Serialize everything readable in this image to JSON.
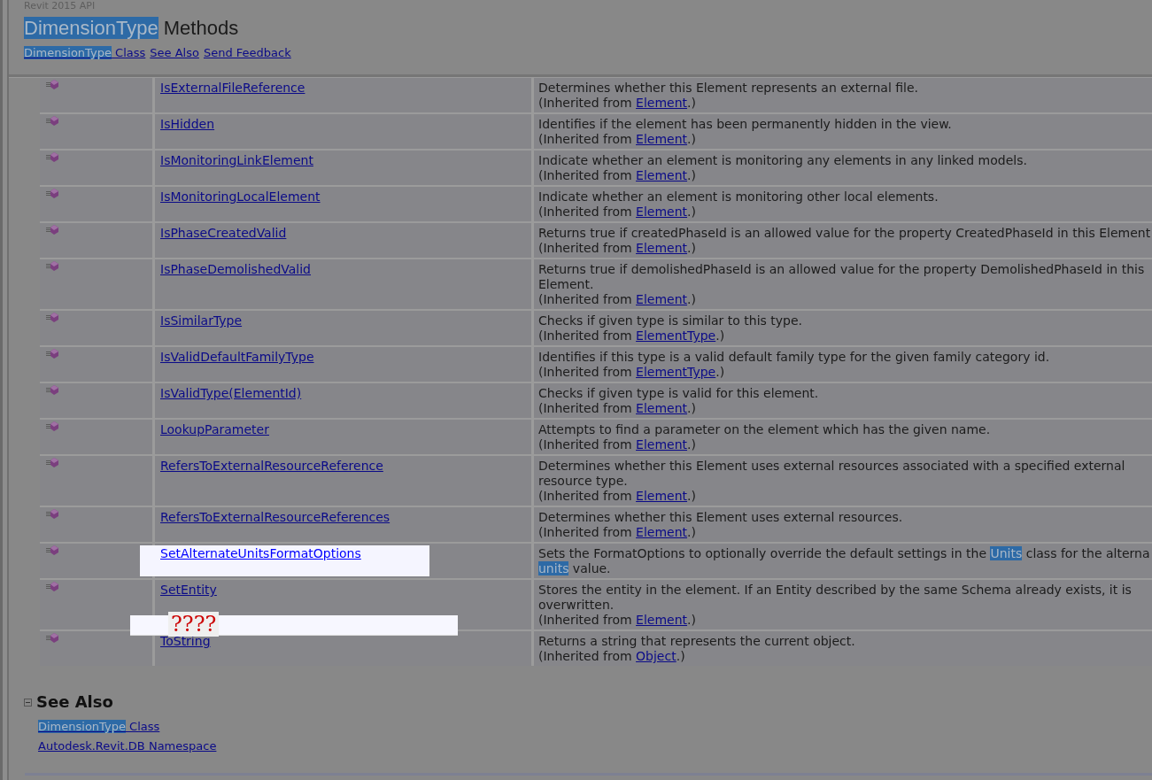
{
  "header": {
    "product": "Revit 2015 API",
    "title": [
      {
        "text": "DimensionType",
        "highlight": true
      },
      {
        "text": " Methods",
        "highlight": false
      }
    ],
    "links": [
      [
        {
          "text": "DimensionType",
          "highlight": true
        },
        {
          "text": " Class",
          "highlight": false
        }
      ],
      [
        {
          "text": "See Also",
          "highlight": false
        }
      ],
      [
        {
          "text": "Send Feedback",
          "highlight": false
        }
      ]
    ]
  },
  "methods": [
    {
      "name": "IsExternalFileReference",
      "highlighted": false,
      "lines": [
        [
          {
            "text": "Determines whether this Element represents an external file.",
            "highlight": false
          }
        ]
      ],
      "inherited": {
        "prefix": "(Inherited from ",
        "link": "Element",
        "suffix": ".)"
      }
    },
    {
      "name": "IsHidden",
      "highlighted": false,
      "lines": [
        [
          {
            "text": "Identifies if the element has been permanently hidden in the view.",
            "highlight": false
          }
        ]
      ],
      "inherited": {
        "prefix": "(Inherited from ",
        "link": "Element",
        "suffix": ".)"
      }
    },
    {
      "name": "IsMonitoringLinkElement",
      "highlighted": false,
      "lines": [
        [
          {
            "text": "Indicate whether an element is monitoring any elements in any linked models.",
            "highlight": false
          }
        ]
      ],
      "inherited": {
        "prefix": "(Inherited from ",
        "link": "Element",
        "suffix": ".)"
      }
    },
    {
      "name": "IsMonitoringLocalElement",
      "highlighted": false,
      "lines": [
        [
          {
            "text": "Indicate whether an element is monitoring other local elements.",
            "highlight": false
          }
        ]
      ],
      "inherited": {
        "prefix": "(Inherited from ",
        "link": "Element",
        "suffix": ".)"
      }
    },
    {
      "name": "IsPhaseCreatedValid",
      "highlighted": false,
      "lines": [
        [
          {
            "text": "Returns true if createdPhaseId is an allowed value for the property CreatedPhaseId in this Element",
            "highlight": false
          }
        ]
      ],
      "inherited": {
        "prefix": "(Inherited from ",
        "link": "Element",
        "suffix": ".)"
      }
    },
    {
      "name": "IsPhaseDemolishedValid",
      "highlighted": false,
      "lines": [
        [
          {
            "text": "Returns true if demolishedPhaseId is an allowed value for the property DemolishedPhaseId in this",
            "highlight": false
          }
        ],
        [
          {
            "text": "Element.",
            "highlight": false
          }
        ]
      ],
      "inherited": {
        "prefix": "(Inherited from ",
        "link": "Element",
        "suffix": ".)"
      }
    },
    {
      "name": "IsSimilarType",
      "highlighted": false,
      "lines": [
        [
          {
            "text": "Checks if given type is similar to this type.",
            "highlight": false
          }
        ]
      ],
      "inherited": {
        "prefix": "(Inherited from ",
        "link": "ElementType",
        "suffix": ".)"
      }
    },
    {
      "name": "IsValidDefaultFamilyType",
      "highlighted": false,
      "lines": [
        [
          {
            "text": "Identifies if this type is a valid default family type for the given family category id.",
            "highlight": false
          }
        ]
      ],
      "inherited": {
        "prefix": "(Inherited from ",
        "link": "ElementType",
        "suffix": ".)"
      }
    },
    {
      "name": "IsValidType(ElementId)",
      "highlighted": false,
      "lines": [
        [
          {
            "text": "Checks if given type is valid for this element.",
            "highlight": false
          }
        ]
      ],
      "inherited": {
        "prefix": "(Inherited from ",
        "link": "Element",
        "suffix": ".)"
      }
    },
    {
      "name": "LookupParameter",
      "highlighted": false,
      "lines": [
        [
          {
            "text": "Attempts to find a parameter on the element which has the given name.",
            "highlight": false
          }
        ]
      ],
      "inherited": {
        "prefix": "(Inherited from ",
        "link": "Element",
        "suffix": ".)"
      }
    },
    {
      "name": "RefersToExternalResourceReference",
      "highlighted": false,
      "lines": [
        [
          {
            "text": "Determines whether this Element uses external resources associated with a specified external",
            "highlight": false
          }
        ],
        [
          {
            "text": "resource type.",
            "highlight": false
          }
        ]
      ],
      "inherited": {
        "prefix": "(Inherited from ",
        "link": "Element",
        "suffix": ".)"
      }
    },
    {
      "name": "RefersToExternalResourceReferences",
      "highlighted": false,
      "lines": [
        [
          {
            "text": "Determines whether this Element uses external resources.",
            "highlight": false
          }
        ]
      ],
      "inherited": {
        "prefix": "(Inherited from ",
        "link": "Element",
        "suffix": ".)"
      }
    },
    {
      "name": "SetAlternateUnitsFormatOptions",
      "highlighted": true,
      "lines": [
        [
          {
            "text": "Sets the FormatOptions to optionally override the default settings in the ",
            "highlight": false
          },
          {
            "text": "Units",
            "highlight": true
          },
          {
            "text": " class for the alterna",
            "highlight": false
          }
        ],
        [
          {
            "text": "units",
            "highlight": true
          },
          {
            "text": " value.",
            "highlight": false
          }
        ]
      ]
    },
    {
      "name": "SetEntity",
      "highlighted": false,
      "lines": [
        [
          {
            "text": "Stores the entity in the element. If an Entity described by the same Schema already exists, it is",
            "highlight": false
          }
        ],
        [
          {
            "text": "overwritten.",
            "highlight": false
          }
        ]
      ],
      "inherited": {
        "prefix": "(Inherited from ",
        "link": "Element",
        "suffix": ".)"
      },
      "note": "????"
    },
    {
      "name": "ToString",
      "highlighted": false,
      "lines": [
        [
          {
            "text": "Returns a string that represents the current object.",
            "highlight": false
          }
        ]
      ],
      "inherited": {
        "prefix": "(Inherited from ",
        "link": "Object",
        "suffix": ".)"
      }
    }
  ],
  "see_also": {
    "title": "See Also",
    "links": [
      [
        {
          "text": "DimensionType",
          "highlight": true
        },
        {
          "text": " Class",
          "highlight": false
        }
      ],
      [
        {
          "text": "Autodesk.Revit.DB Namespace",
          "highlight": false
        }
      ]
    ]
  }
}
